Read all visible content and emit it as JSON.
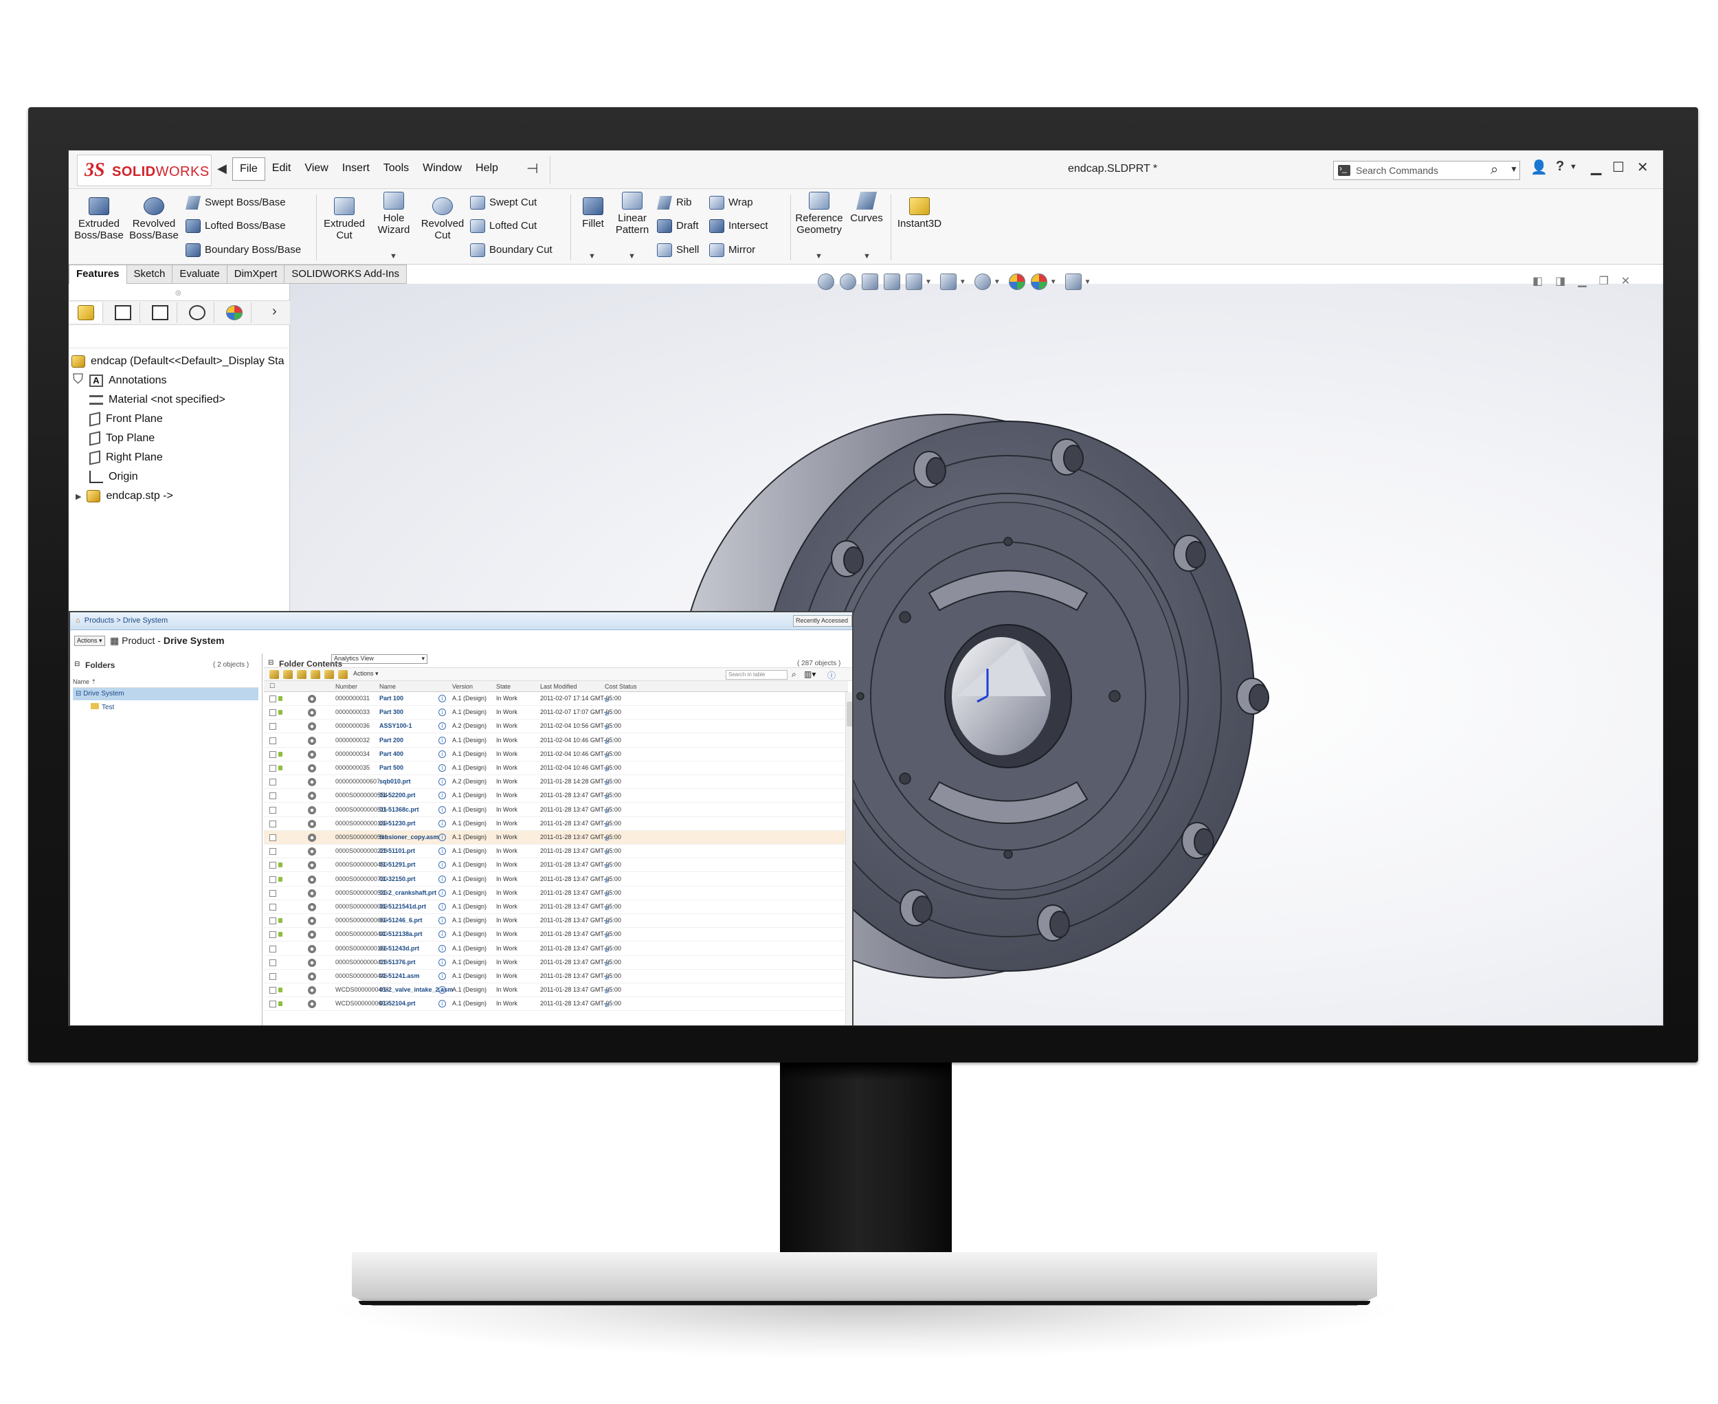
{
  "app": {
    "logo_ds": "3S",
    "logo_solid": "SOLID",
    "logo_works": "WORKS",
    "document_title": "endcap.SLDPRT *"
  },
  "menu": [
    {
      "label": "File",
      "active": true
    },
    {
      "label": "Edit",
      "active": false
    },
    {
      "label": "View",
      "active": false
    },
    {
      "label": "Insert",
      "active": false
    },
    {
      "label": "Tools",
      "active": false
    },
    {
      "label": "Window",
      "active": false
    },
    {
      "label": "Help",
      "active": false
    }
  ],
  "search": {
    "placeholder": "Search Commands"
  },
  "commands": {
    "extruded_boss": "Extruded Boss/Base",
    "revolved_boss": "Revolved Boss/Base",
    "swept_boss": "Swept Boss/Base",
    "lofted_boss": "Lofted Boss/Base",
    "boundary_boss": "Boundary Boss/Base",
    "extruded_cut": "Extruded Cut",
    "hole_wizard": "Hole Wizard",
    "revolved_cut": "Revolved Cut",
    "swept_cut": "Swept Cut",
    "lofted_cut": "Lofted Cut",
    "boundary_cut": "Boundary Cut",
    "fillet": "Fillet",
    "linear_pattern": "Linear Pattern",
    "rib": "Rib",
    "draft": "Draft",
    "shell": "Shell",
    "wrap": "Wrap",
    "intersect": "Intersect",
    "mirror": "Mirror",
    "reference_geometry": "Reference Geometry",
    "curves": "Curves",
    "instant3d": "Instant3D"
  },
  "tabs": [
    {
      "label": "Features",
      "active": true
    },
    {
      "label": "Sketch",
      "active": false
    },
    {
      "label": "Evaluate",
      "active": false
    },
    {
      "label": "DimXpert",
      "active": false
    },
    {
      "label": "SOLIDWORKS Add-Ins",
      "active": false
    }
  ],
  "feature_tree": {
    "root": "endcap  (Default<<Default>_Display Sta",
    "items": [
      {
        "label": "Annotations",
        "icon": "annotations-icon"
      },
      {
        "label": "Material <not specified>",
        "icon": "material-icon"
      },
      {
        "label": "Front Plane",
        "icon": "plane-icon"
      },
      {
        "label": "Top Plane",
        "icon": "plane-icon"
      },
      {
        "label": "Right Plane",
        "icon": "plane-icon"
      },
      {
        "label": "Origin",
        "icon": "origin-icon"
      },
      {
        "label": "endcap.stp ->",
        "icon": "part-icon"
      }
    ]
  },
  "pdm": {
    "breadcrumb": "Products  >  Drive System",
    "recently_accessed": "Recently Accessed",
    "actions": "Actions",
    "title_prefix": "Product - ",
    "title_name": "Drive System",
    "folders_title": "Folders",
    "folders_count": "( 2 objects )",
    "folder_name_header": "Name",
    "folders": [
      {
        "label": "Drive System",
        "selected": true
      },
      {
        "label": "Test",
        "selected": false
      }
    ],
    "contents_title": "Folder Contents",
    "contents_view": "Analytics View",
    "contents_count": "( 287 objects )",
    "search_placeholder": "Search in table",
    "columns": {
      "number": "Number",
      "name": "Name",
      "version": "Version",
      "state": "State",
      "last_modified": "Last Modified",
      "cost_status": "Cost Status"
    },
    "rows": [
      {
        "number": "0000000031",
        "name": "Part 100",
        "version": "A.1 (Design)",
        "state": "In Work",
        "modified": "2011-02-07 17:14 GMT-05:00",
        "tag": true
      },
      {
        "number": "0000000033",
        "name": "Part 300",
        "version": "A.1 (Design)",
        "state": "In Work",
        "modified": "2011-02-07 17:07 GMT-05:00",
        "tag": true
      },
      {
        "number": "0000000036",
        "name": "ASSY100-1",
        "version": "A.2 (Design)",
        "state": "In Work",
        "modified": "2011-02-04 10:56 GMT-05:00",
        "tag": false
      },
      {
        "number": "0000000032",
        "name": "Part 200",
        "version": "A.1 (Design)",
        "state": "In Work",
        "modified": "2011-02-04 10:46 GMT-05:00",
        "tag": false
      },
      {
        "number": "0000000034",
        "name": "Part 400",
        "version": "A.1 (Design)",
        "state": "In Work",
        "modified": "2011-02-04 10:46 GMT-05:00",
        "tag": true
      },
      {
        "number": "0000000035",
        "name": "Part 500",
        "version": "A.1 (Design)",
        "state": "In Work",
        "modified": "2011-02-04 10:46 GMT-05:00",
        "tag": true
      },
      {
        "number": "0000000000607",
        "name": "sqb010.prt",
        "version": "A.2 (Design)",
        "state": "In Work",
        "modified": "2011-01-28 14:28 GMT-05:00",
        "tag": false
      },
      {
        "number": "0000S0000000554",
        "name": "01-52200.prt",
        "version": "A.1 (Design)",
        "state": "In Work",
        "modified": "2011-01-28 13:47 GMT-05:00",
        "tag": false
      },
      {
        "number": "0000S0000000511",
        "name": "01-51368c.prt",
        "version": "A.1 (Design)",
        "state": "In Work",
        "modified": "2011-01-28 13:47 GMT-05:00",
        "tag": false
      },
      {
        "number": "0000S0000000139",
        "name": "01-51230.prt",
        "version": "A.1 (Design)",
        "state": "In Work",
        "modified": "2011-01-28 13:47 GMT-05:00",
        "tag": false
      },
      {
        "number": "0000S0000000591",
        "name": "tensioner_copy.asm",
        "version": "A.1 (Design)",
        "state": "In Work",
        "modified": "2011-01-28 13:47 GMT-05:00",
        "tag": false,
        "highlight": true
      },
      {
        "number": "0000S0000000228",
        "name": "01-51101.prt",
        "version": "A.1 (Design)",
        "state": "In Work",
        "modified": "2011-01-28 13:47 GMT-05:00",
        "tag": false
      },
      {
        "number": "0000S0000000450",
        "name": "01-51291.prt",
        "version": "A.1 (Design)",
        "state": "In Work",
        "modified": "2011-01-28 13:47 GMT-05:00",
        "tag": true
      },
      {
        "number": "0000S0000000730",
        "name": "01-32150.prt",
        "version": "A.1 (Design)",
        "state": "In Work",
        "modified": "2011-01-28 13:47 GMT-05:00",
        "tag": true
      },
      {
        "number": "0000S0000000533",
        "name": "01-2_crankshaft.prt",
        "version": "A.1 (Design)",
        "state": "In Work",
        "modified": "2011-01-28 13:47 GMT-05:00",
        "tag": false
      },
      {
        "number": "0000S0000000082",
        "name": "01-5121541d.prt",
        "version": "A.1 (Design)",
        "state": "In Work",
        "modified": "2011-01-28 13:47 GMT-05:00",
        "tag": false
      },
      {
        "number": "0000S0000000669",
        "name": "01-51246_6.prt",
        "version": "A.1 (Design)",
        "state": "In Work",
        "modified": "2011-01-28 13:47 GMT-05:00",
        "tag": true
      },
      {
        "number": "0000S0000000440",
        "name": "01-512138a.prt",
        "version": "A.1 (Design)",
        "state": "In Work",
        "modified": "2011-01-28 13:47 GMT-05:00",
        "tag": true
      },
      {
        "number": "0000S0000000166",
        "name": "01-51243d.prt",
        "version": "A.1 (Design)",
        "state": "In Work",
        "modified": "2011-01-28 13:47 GMT-05:00",
        "tag": false
      },
      {
        "number": "0000S0000000428",
        "name": "01-51376.prt",
        "version": "A.1 (Design)",
        "state": "In Work",
        "modified": "2011-01-28 13:47 GMT-05:00",
        "tag": false
      },
      {
        "number": "0000S0000000446",
        "name": "01-51241.asm",
        "version": "A.1 (Design)",
        "state": "In Work",
        "modified": "2011-01-28 13:47 GMT-05:00",
        "tag": false
      },
      {
        "number": "WCDS0000000468",
        "name": "01-2_valve_intake_2.asm",
        "version": "A.1 (Design)",
        "state": "In Work",
        "modified": "2011-01-28 13:47 GMT-05:00",
        "tag": true
      },
      {
        "number": "WCDS0000000693",
        "name": "01-52104.prt",
        "version": "A.1 (Design)",
        "state": "In Work",
        "modified": "2011-01-28 13:47 GMT-05:00",
        "tag": true
      }
    ]
  },
  "colors": {
    "brand_red": "#d2232a",
    "model_gray": "#5d6170",
    "selection_blue": "#bcd6ee",
    "link_blue": "#1b4a86"
  }
}
